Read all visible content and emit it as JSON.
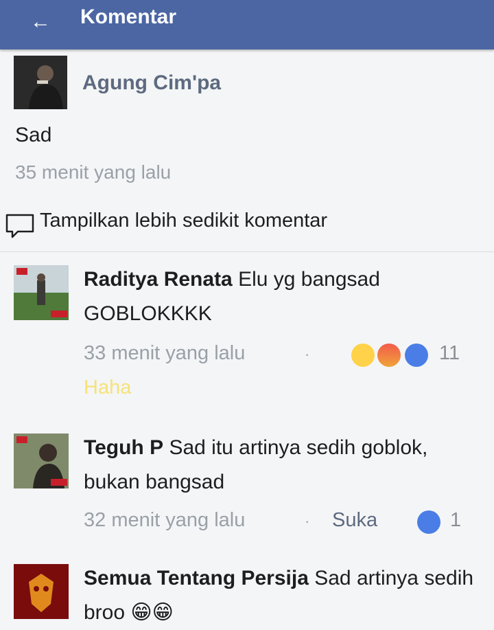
{
  "header": {
    "title": "Komentar",
    "back_icon": "arrow-left-icon"
  },
  "post": {
    "author": "Agung Cim'pa",
    "text": "Sad",
    "time": "35 menit yang lalu"
  },
  "show_less": "Tampilkan lebih sedikit komentar",
  "comments": [
    {
      "author": "Raditya Renata",
      "text": "Elu yg bangsad GOBLOKKKK",
      "time": "33 menit yang lalu",
      "separator": "·",
      "reactions": [
        "haha-icon",
        "angry-icon",
        "like-icon"
      ],
      "reaction_count": "11",
      "my_reaction": "Haha"
    },
    {
      "author": "Teguh P",
      "text": "Sad itu artinya sedih goblok,  bukan bangsad",
      "time": "32 menit yang lalu",
      "separator": "·",
      "like_label": "Suka",
      "reactions": [
        "like-icon"
      ],
      "reaction_count": "1"
    },
    {
      "author": "Semua Tentang Persija",
      "text": "Sad artinya sedih broo 😁😁"
    }
  ],
  "colors": {
    "topbar": "#4b66a3",
    "name_gray": "#5d6a80",
    "time_gray": "#9aa0a8",
    "haha_label": "#f5e27a",
    "like_blue": "#4a7ee6"
  }
}
